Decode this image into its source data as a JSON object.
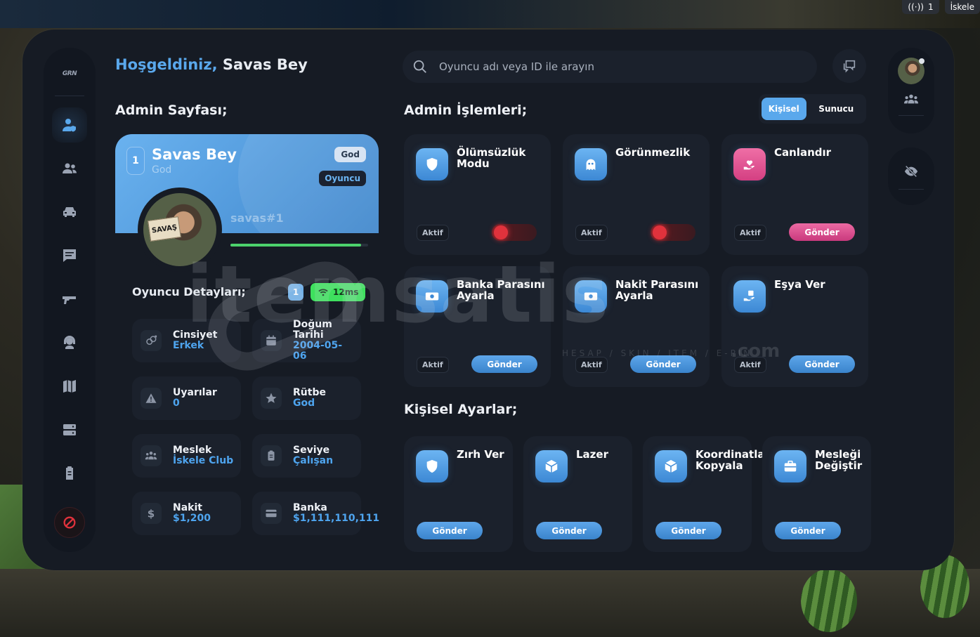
{
  "hud": {
    "count": "1",
    "location": "İskele"
  },
  "sidebar": {
    "logo": "GRN",
    "items": [
      {
        "icon": "user-shield-icon",
        "active": true
      },
      {
        "icon": "users-icon",
        "active": false
      },
      {
        "icon": "car-icon",
        "active": false
      },
      {
        "icon": "message-icon",
        "active": false
      },
      {
        "icon": "gun-icon",
        "active": false
      },
      {
        "icon": "headset-icon",
        "active": false
      },
      {
        "icon": "map-icon",
        "active": false
      },
      {
        "icon": "server-icon",
        "active": false
      },
      {
        "icon": "clipboard-icon",
        "active": false
      }
    ],
    "ban_icon": "ban-icon"
  },
  "header": {
    "welcome_prefix": "Hoşgeldiniz,",
    "welcome_name": "Savas Bey",
    "search_placeholder": "Oyuncu adı veya ID ile arayın"
  },
  "admin_page": {
    "title": "Admin Sayfası;",
    "profile": {
      "id": "1",
      "name": "Savas Bey",
      "grade": "God",
      "god_tag": "God",
      "role_tag": "Oyuncu",
      "nick": "savas#1",
      "avatar_sign": "SAVAŞ",
      "progress": 0.95
    },
    "details_title": "Oyuncu Detayları;",
    "details_badge": "1",
    "ping": "12ms",
    "stats": [
      {
        "label": "Cinsiyet",
        "value": "Erkek",
        "icon": "gender-icon"
      },
      {
        "label": "Doğum Tarihi",
        "value": "2004-05-06",
        "icon": "calendar-icon"
      },
      {
        "label": "Uyarılar",
        "value": "0",
        "icon": "warning-icon"
      },
      {
        "label": "Rütbe",
        "value": "God",
        "icon": "star-icon"
      },
      {
        "label": "Meslek",
        "value": "İskele Club",
        "icon": "people-icon"
      },
      {
        "label": "Seviye",
        "value": "Çalışan",
        "icon": "badge-icon"
      },
      {
        "label": "Nakit",
        "value": "$1,200",
        "icon": "dollar-icon"
      },
      {
        "label": "Banka",
        "value": "$1,111,110,111",
        "icon": "card-icon"
      }
    ]
  },
  "admin_actions": {
    "title": "Admin İşlemleri;",
    "tabs": [
      "Kişisel",
      "Sunucu"
    ],
    "active_tab": "Kişisel",
    "aktif_label": "Aktif",
    "send_label": "Gönder",
    "cards": [
      {
        "title": "Ölümsüzlük Modu",
        "icon": "shield-icon",
        "type": "switch",
        "on": false
      },
      {
        "title": "Görünmezlik",
        "icon": "ghost-icon",
        "type": "switch",
        "on": false
      },
      {
        "title": "Canlandır",
        "icon": "heart-hand-icon",
        "type": "send",
        "accent": "#d43f82"
      },
      {
        "title": "Banka Parasını Ayarla",
        "icon": "money-icon",
        "type": "send"
      },
      {
        "title": "Nakit Parasını Ayarla",
        "icon": "money-icon",
        "type": "send"
      },
      {
        "title": "Eşya Ver",
        "icon": "give-item-icon",
        "type": "send"
      }
    ]
  },
  "personal_settings": {
    "title": "Kişisel Ayarlar;",
    "send_label": "Gönder",
    "cards": [
      {
        "title": "Zırh Ver",
        "icon": "shield-icon"
      },
      {
        "title": "Lazer",
        "icon": "cube-icon"
      },
      {
        "title": "Koordinatları Kopyala",
        "icon": "cube-icon"
      },
      {
        "title": "Mesleği Değiştir",
        "icon": "briefcase-icon"
      }
    ]
  },
  "watermark": {
    "text": "itemsatis",
    "sub": "HESAP / SKIN / ITEM / E-PIN",
    "com": ".com"
  },
  "colors": {
    "accent": "#5aa8ec",
    "pink": "#d43f82",
    "panel": "#161b24",
    "card": "#1b212c",
    "success": "#3ee05e",
    "danger": "#e0323c"
  }
}
